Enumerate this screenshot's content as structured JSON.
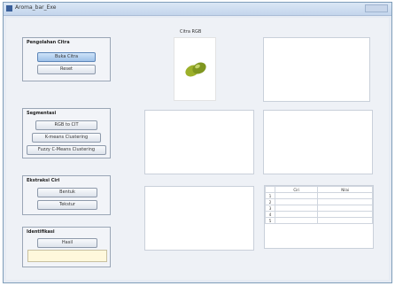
{
  "window": {
    "title": "Aroma_bar_Exe"
  },
  "preprocessing": {
    "title": "Pengolahan Citra",
    "buttons": [
      "Buka Citra",
      "Reset"
    ]
  },
  "segmentation": {
    "title": "Segmentasi",
    "buttons": [
      "RGB to CIT",
      "K-means Clustering",
      "Fuzzy C-Means Clustering"
    ]
  },
  "feature": {
    "title": "Ekstraksi Ciri",
    "buttons": [
      "Bentuk",
      "Tekstur"
    ]
  },
  "identify": {
    "title": "Identifikasi",
    "button": "Hasil",
    "result": ""
  },
  "images": {
    "rgb_label": "Citra RGB"
  },
  "table": {
    "headers": [
      "",
      "Ciri",
      "Nilai"
    ],
    "rows": [
      [
        "1",
        "",
        ""
      ],
      [
        "2",
        "",
        ""
      ],
      [
        "3",
        "",
        ""
      ],
      [
        "4",
        "",
        ""
      ],
      [
        "5",
        "",
        ""
      ]
    ]
  }
}
